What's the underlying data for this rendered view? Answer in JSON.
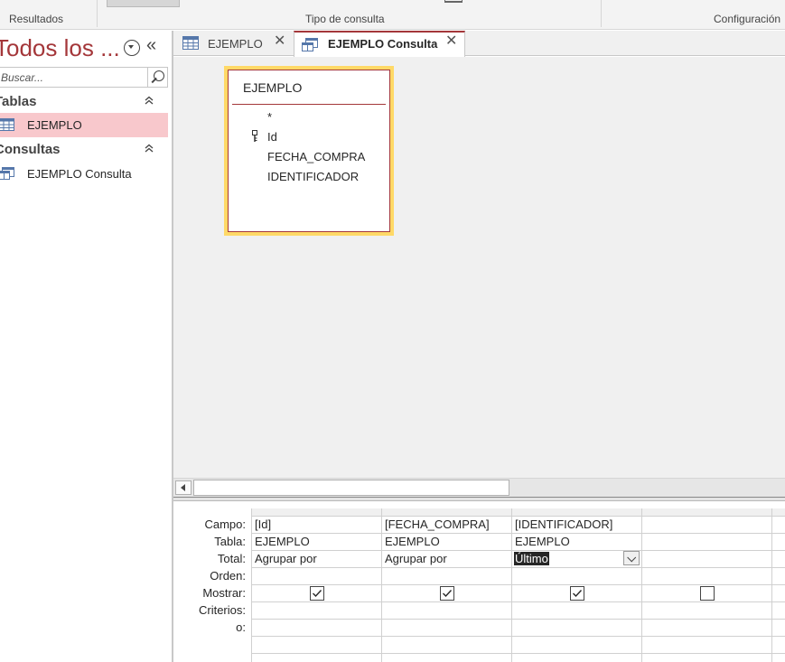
{
  "ribbon": {
    "groups": [
      {
        "label": "Resultados"
      },
      {
        "label": "Tipo de consulta"
      },
      {
        "label": "Configuración"
      }
    ]
  },
  "nav": {
    "title": "Todos los ...",
    "search_placeholder": "Buscar...",
    "groups": [
      {
        "label": "Tablas",
        "items": [
          {
            "label": "EJEMPLO",
            "selected": true
          }
        ]
      },
      {
        "label": "Consultas",
        "items": [
          {
            "label": "EJEMPLO Consulta",
            "selected": false
          }
        ]
      }
    ]
  },
  "tabs": [
    {
      "label": "EJEMPLO",
      "active": false
    },
    {
      "label": "EJEMPLO Consulta",
      "active": true
    }
  ],
  "table_box": {
    "title": "EJEMPLO",
    "fields": [
      "*",
      "Id",
      "FECHA_COMPRA",
      "IDENTIFICADOR"
    ],
    "primary_key": "Id"
  },
  "grid": {
    "row_labels": [
      "Campo:",
      "Tabla:",
      "Total:",
      "Orden:",
      "Mostrar:",
      "Criterios:",
      "o:"
    ],
    "columns": [
      {
        "campo": "[Id]",
        "tabla": "EJEMPLO",
        "total": "Agrupar por",
        "mostrar": true
      },
      {
        "campo": "[FECHA_COMPRA]",
        "tabla": "EJEMPLO",
        "total": "Agrupar por",
        "mostrar": true
      },
      {
        "campo": "[IDENTIFICADOR]",
        "tabla": "EJEMPLO",
        "total": "Último",
        "mostrar": true
      },
      {
        "campo": "",
        "tabla": "",
        "total": "",
        "mostrar": false
      }
    ]
  },
  "colors": {
    "accent": "#a4373a",
    "selection": "#f8c8cc",
    "table_highlight": "#ffd967"
  }
}
